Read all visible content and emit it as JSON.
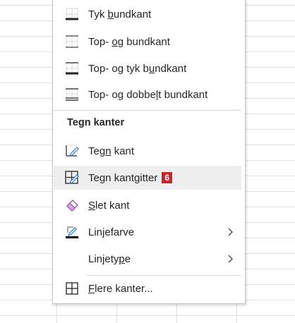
{
  "menu": {
    "items_top": [
      {
        "label": "Tyk bundkant",
        "icon": "thick-bottom-border-icon"
      },
      {
        "label": "Top- og bundkant",
        "icon": "top-bottom-border-icon"
      },
      {
        "label": "Top- og tyk bundkant",
        "icon": "top-thick-bottom-border-icon"
      },
      {
        "label": "Top- og dobbelt bundkant",
        "icon": "top-double-bottom-border-icon"
      }
    ],
    "section_header": "Tegn kanter",
    "items_draw": [
      {
        "label": "Tegn kant",
        "icon": "draw-border-icon"
      },
      {
        "label": "Tegn kantgitter",
        "icon": "draw-border-grid-icon",
        "badge": "6"
      },
      {
        "label": "Slet kant",
        "icon": "eraser-icon"
      },
      {
        "label": "Linjefarve",
        "icon": "line-color-icon",
        "submenu": true,
        "color": "#000000"
      },
      {
        "label": "Linjetype",
        "icon": "",
        "submenu": true
      }
    ],
    "more_label": "Flere kanter...",
    "accent_color": "#2b7cd3",
    "badge_color": "#c4262e"
  }
}
